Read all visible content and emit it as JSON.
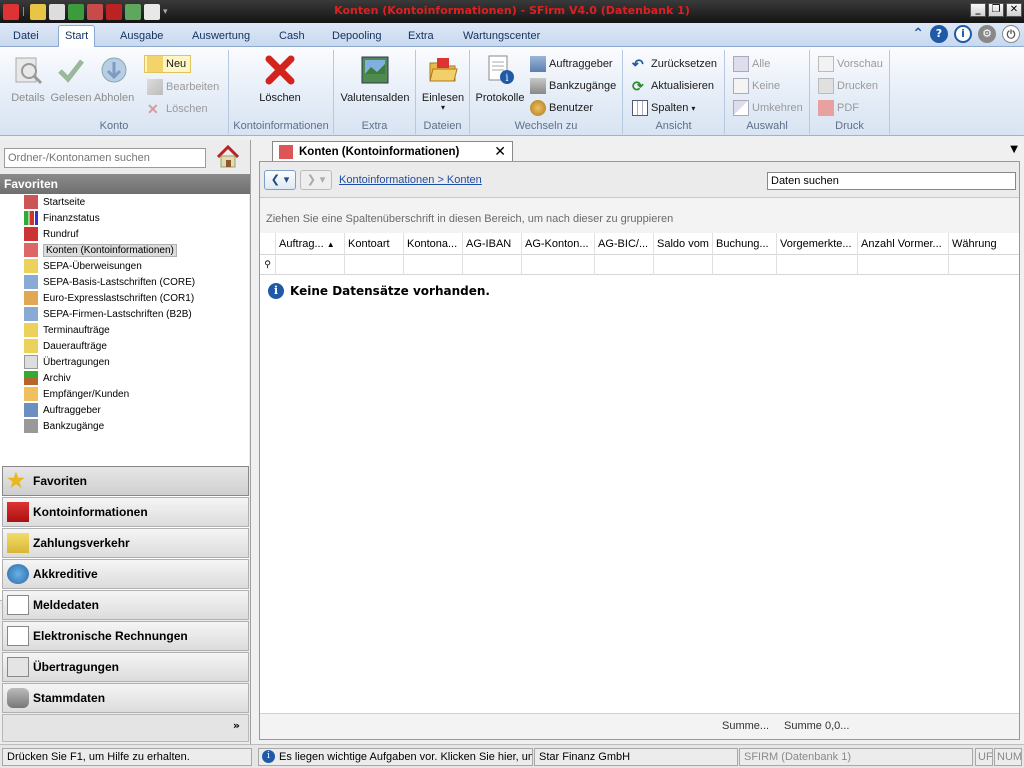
{
  "window": {
    "title": "Konten (Kontoinformationen) - SFirm V4.0 (Datenbank 1)",
    "buttons": {
      "minimize": "_",
      "maximize": "❐",
      "close": "✕"
    }
  },
  "ribbon_tabs": [
    "Datei",
    "Start",
    "Ausgabe",
    "Auswertung",
    "Cash",
    "Depooling",
    "Extra",
    "Wartungscenter"
  ],
  "ribbon": {
    "konto": {
      "label": "Konto",
      "details": "Details",
      "gelesen": "Gelesen",
      "abholen": "Abholen",
      "neu": "Neu",
      "bearbeiten": "Bearbeiten",
      "loeschen": "Löschen"
    },
    "kontoinfo": {
      "label": "Kontoinformationen",
      "loeschen": "Löschen"
    },
    "extra": {
      "label": "Extra",
      "valutensalden": "Valutensalden"
    },
    "dateien": {
      "label": "Dateien",
      "einlesen": "Einlesen"
    },
    "wechseln": {
      "label": "Wechseln zu",
      "protokolle": "Protokolle",
      "auftraggeber": "Auftraggeber",
      "bankzugaenge": "Bankzugänge",
      "benutzer": "Benutzer"
    },
    "ansicht": {
      "label": "Ansicht",
      "zuruecksetzen": "Zurücksetzen",
      "aktualisieren": "Aktualisieren",
      "spalten": "Spalten"
    },
    "auswahl": {
      "label": "Auswahl",
      "alle": "Alle",
      "keine": "Keine",
      "umkehren": "Umkehren"
    },
    "druck": {
      "label": "Druck",
      "vorschau": "Vorschau",
      "drucken": "Drucken",
      "pdf": "PDF"
    }
  },
  "sidebar": {
    "search_placeholder": "Ordner-/Kontonamen suchen",
    "favorites_header": "Favoriten",
    "tree": [
      "Startseite",
      "Finanzstatus",
      "Rundruf",
      "Konten (Kontoinformationen)",
      "SEPA-Überweisungen",
      "SEPA-Basis-Lastschriften (CORE)",
      "Euro-Expresslastschriften (COR1)",
      "SEPA-Firmen-Lastschriften (B2B)",
      "Terminaufträge",
      "Daueraufträge",
      "Übertragungen",
      "Archiv",
      "Empfänger/Kunden",
      "Auftraggeber",
      "Bankzugänge"
    ],
    "nav": [
      "Favoriten",
      "Kontoinformationen",
      "Zahlungsverkehr",
      "Akkreditive",
      "Meldedaten",
      "Elektronische Rechnungen",
      "Übertragungen",
      "Stammdaten"
    ],
    "more": "»"
  },
  "main": {
    "tab_title": "Konten (Kontoinformationen)",
    "tab_close": "✕",
    "breadcrumb": "Kontoinformationen > Konten",
    "data_search_value": "Daten suchen",
    "group_hint": "Ziehen Sie eine Spaltenüberschrift in diesen Bereich, um nach dieser zu gruppieren",
    "columns": [
      "Auftrag...",
      "Kontoart",
      "Kontona...",
      "AG-IBAN",
      "AG-Konton...",
      "AG-BIC/...",
      "Saldo vom",
      "Buchung...",
      "Vorgemerkte...",
      "Anzahl Vormer...",
      "Währung"
    ],
    "no_data": "Keine Datensätze vorhanden.",
    "footer": {
      "sum1": "Summe...",
      "sum2": "Summe 0,0..."
    }
  },
  "statusbar": {
    "help": "Drücken Sie F1, um Hilfe zu erhalten.",
    "tasks": "Es liegen wichtige Aufgaben vor. Klicken Sie hier, um",
    "company": "Star Finanz GmbH",
    "db": "SFIRM (Datenbank 1)",
    "uf": "UF",
    "num": "NUM"
  },
  "colors": {
    "title_text": "#e02020",
    "ribbon_top": "#fbfcfe",
    "ribbon_bottom": "#d8e4f3",
    "accent_blue": "#1f5aa8",
    "link_blue": "#1d4ea5"
  }
}
